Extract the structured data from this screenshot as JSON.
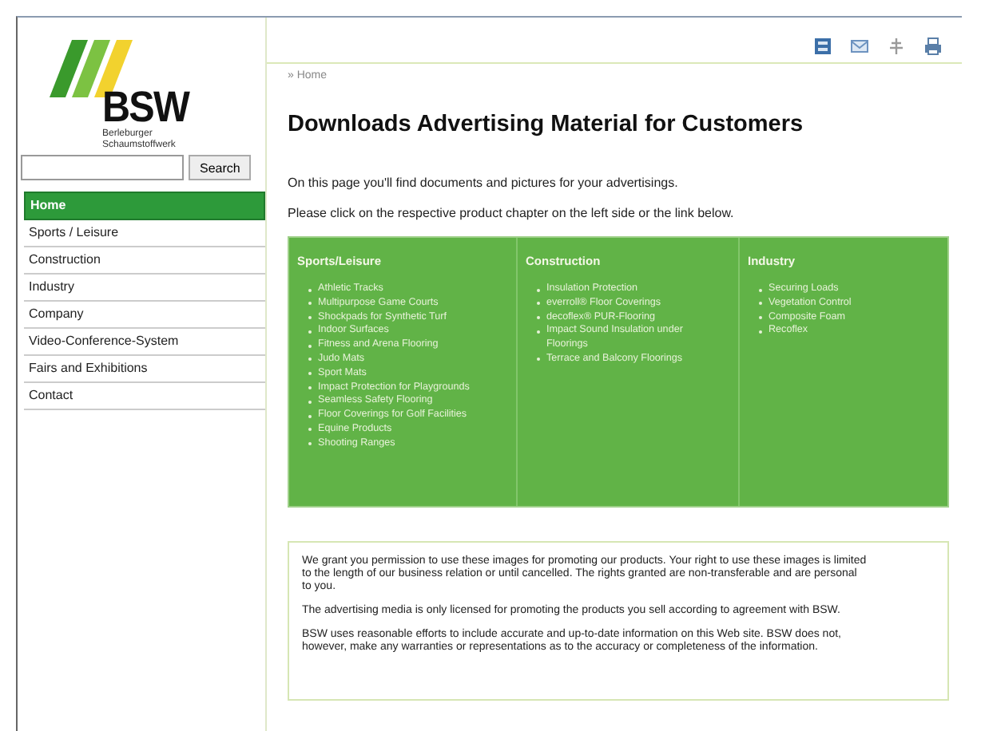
{
  "logo": {
    "name": "BSW",
    "subtitle_lines": [
      "Berleburger",
      "Schaumstoffwerk"
    ]
  },
  "search": {
    "button": "Search"
  },
  "nav": [
    {
      "label": "Home",
      "selected": true
    },
    {
      "label": "Sports / Leisure",
      "selected": false
    },
    {
      "label": "Construction",
      "selected": false
    },
    {
      "label": "Industry",
      "selected": false
    },
    {
      "label": "Company",
      "selected": false
    },
    {
      "label": "Video-Conference-System",
      "selected": false
    },
    {
      "label": "Fairs and Exhibitions",
      "selected": false
    },
    {
      "label": "Contact",
      "selected": false
    }
  ],
  "toolbar": [
    {
      "kind": "sitemap"
    },
    {
      "kind": "mail"
    },
    {
      "kind": "share"
    },
    {
      "kind": "print"
    }
  ],
  "breadcrumb": "» Home",
  "title": "Downloads Advertising Material for Customers",
  "intro": [
    "On this page you'll find documents and pictures for your advertisings.",
    "Please click on the respective product chapter on the left side or the link below."
  ],
  "categories": [
    {
      "heading": "Sports/Leisure",
      "items": [
        "Athletic Tracks",
        "Multipurpose Game Courts",
        "Shockpads for Synthetic Turf",
        "Indoor Surfaces",
        "Fitness and Arena Flooring",
        "Judo Mats",
        "Sport Mats",
        "Impact Protection for Playgrounds",
        "Seamless Safety Flooring",
        "Floor Coverings for Golf Facilities",
        "Equine Products",
        "Shooting Ranges"
      ]
    },
    {
      "heading": "Construction",
      "items": [
        "Insulation Protection",
        "everroll® Floor Coverings",
        "decoflex® PUR-Flooring",
        "Impact Sound Insulation under Floorings",
        "Terrace and Balcony Floorings"
      ]
    },
    {
      "heading": "Industry",
      "items": [
        "Securing Loads",
        "Vegetation Control",
        "Composite Foam",
        "Recoflex"
      ]
    }
  ],
  "disclaimer": [
    "We grant you permission to use these images for promoting our products. Your right to use these images is limited to the length of our business relation or until cancelled. The rights granted are non-transferable and are personal to you.",
    "The advertising media is only licensed for promoting the products you sell according to agreement with BSW.",
    "BSW uses reasonable efforts to include accurate and up-to-date information on this Web site. BSW does not, however, make any warranties or representations as to the accuracy or completeness of the information."
  ]
}
